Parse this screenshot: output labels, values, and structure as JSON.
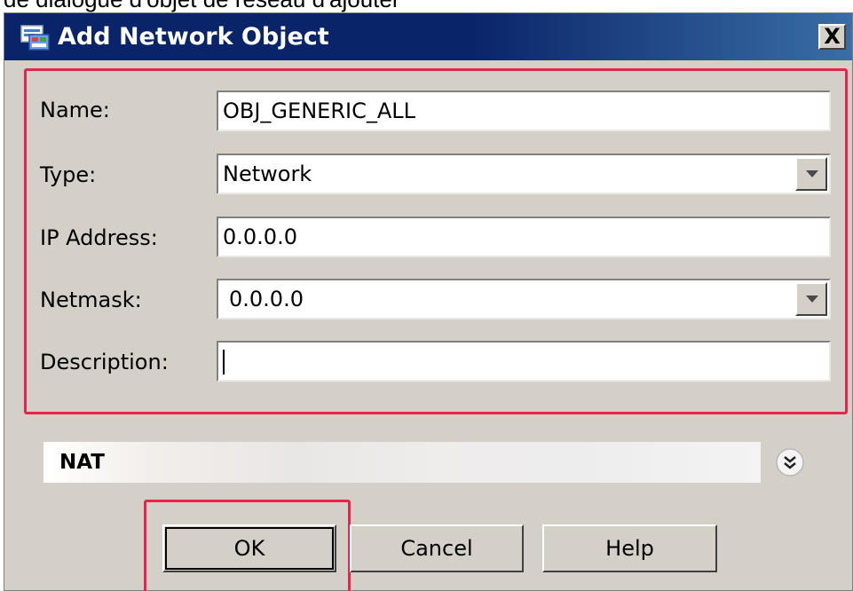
{
  "caption": "de dialogue d'objet de réseau d'ajouter",
  "dialog": {
    "title": "Add Network Object",
    "close_label": "X"
  },
  "fields": {
    "name": {
      "label": "Name:",
      "value": "OBJ_GENERIC_ALL"
    },
    "type": {
      "label": "Type:",
      "value": "Network"
    },
    "ip_address": {
      "label": "IP Address:",
      "value": "0.0.0.0"
    },
    "netmask": {
      "label": "Netmask:",
      "value": "0.0.0.0"
    },
    "description": {
      "label": "Description:",
      "value": ""
    }
  },
  "nat": {
    "label": "NAT"
  },
  "buttons": {
    "ok": "OK",
    "cancel": "Cancel",
    "help": "Help"
  },
  "colors": {
    "title_bar": "#0a246a",
    "highlight": "#e5264a",
    "dialog_bg": "#d4d0c8"
  }
}
